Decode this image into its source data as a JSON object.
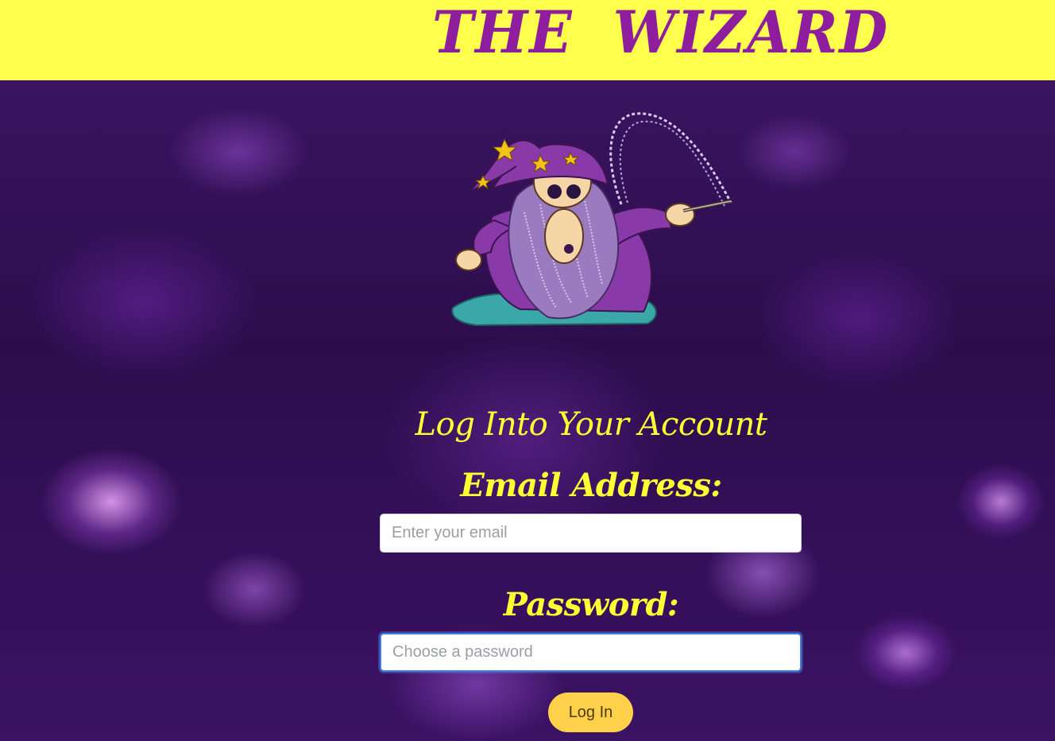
{
  "header": {
    "brand_word_1": "THE",
    "brand_word_2": "WIZARD",
    "background_color": "#ffff4d",
    "brand_color": "#8e1e9e"
  },
  "hero": {
    "image_icon": "wizard-with-wand-icon"
  },
  "login": {
    "title": "Log Into Your Account",
    "email_label": "Email Address:",
    "email_placeholder": "Enter your email",
    "email_value": "",
    "password_label": "Password:",
    "password_placeholder": "Choose a password",
    "password_value": "",
    "submit_label": "Log In",
    "label_color": "#ffff33",
    "button_color": "#ffd04a"
  }
}
